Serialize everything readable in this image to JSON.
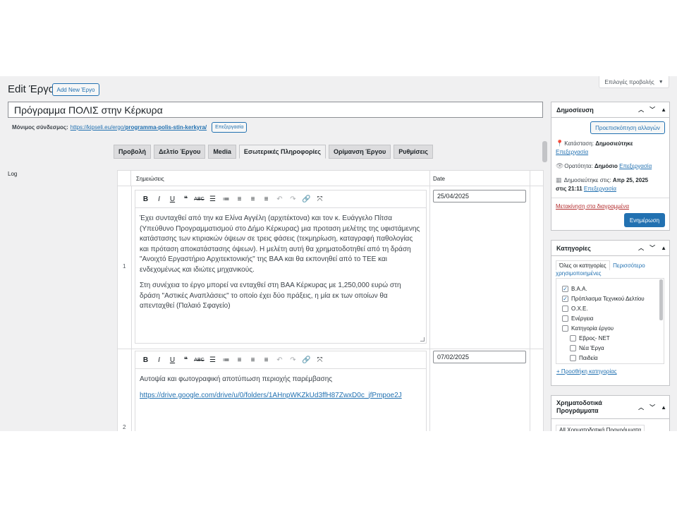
{
  "header": {
    "screen_options": "Επιλογές προβολής",
    "page_title": "Edit Έργο",
    "add_new": "Add New Έργο"
  },
  "post": {
    "title": "Πρόγραμμα ΠΟΛΙΣ στην Κέρκυρα",
    "permalink_label": "Μόνιμος σύνδεσμος:",
    "permalink_base": "https://kipseli.eu/ergo/",
    "permalink_slug": "programma-polis-stin-kerkyra/",
    "permalink_edit": "Επεξεργασία"
  },
  "tabs": [
    {
      "label": "Προβολή"
    },
    {
      "label": "Δελτίο Έργου"
    },
    {
      "label": "Media"
    },
    {
      "label": "Εσωτερικές Πληροφορίες",
      "active": true
    },
    {
      "label": "Ορίμανση Έργου"
    },
    {
      "label": "Ρυθμίσεις"
    }
  ],
  "log": {
    "label": "Log",
    "col_notes": "Σημειώσεις",
    "col_date": "Date",
    "rows": [
      {
        "num": "1",
        "date": "25/04/2025",
        "p1": "Έχει συνταχθεί από την κα Ελίνα Αγγέλη (αρχιτέκτονα) και τον κ. Ευάγγελο Πίτσα (Υπεύθυνο Προγραμματισμού στο Δήμο Κέρκυρας) μια προταση μελέτης της υφιστάμενης κατάστασης των κτιριακών όψεων σε τρεις φάσεις (τεκμηρίωση, καταγραφή παθολογίας και πρόταση αποκατάστασης όψεων). Η μελέτη αυτή θα χρηματοδοτηθεί από τη δράση \"Ανοιχτό Εργαστήριο Αρχιτεκτονικής\" της ΒΑΑ και θα εκπονηθεί από το ΤΕΕ και ενδεχομένως και ιδιώτες μηχανικούς.",
        "p2": "Στη συνέχεια το έργο μπορεί να ενταχθεί στη ΒΑΑ Κέρκυρας με 1,250,000 ευρώ στη δράση \"Αστικές Αναπλάσεις\" το οποίο έχει δύο πράξεις, η μία εκ των οποίων θα απενταχθεί (Παλαιό Σφαγείο)"
      },
      {
        "num": "2",
        "date": "07/02/2025",
        "p1": "Αυτοψία και φωτογραφική αποτύπωση περιοχής παρέμβασης",
        "link": "https://drive.google.com/drive/u/0/folders/1AHnpWKZkUd3ffH87ZwxD0c_jfPmpoe2J"
      }
    ]
  },
  "toolbar_icons": [
    "bold-icon",
    "italic-icon",
    "underline-icon",
    "blockquote-icon",
    "strikethrough-icon",
    "bullet-list-icon",
    "numbered-list-icon",
    "align-left-icon",
    "align-center-icon",
    "align-right-icon",
    "undo-icon",
    "redo-icon",
    "link-icon",
    "fullscreen-icon"
  ],
  "publish": {
    "title": "Δημοσίευση",
    "preview": "Προεπισκόπηση αλλαγών",
    "status_label": "Κατάσταση:",
    "status_value": "Δημοσιεύτηκε",
    "status_edit": "Επεξεργασία",
    "visibility_label": "Ορατότητα:",
    "visibility_value": "Δημόσιο",
    "visibility_edit": "Επεξεργασία",
    "published_label": "Δημοσιεύτηκε στις:",
    "published_value_a": "Απρ 25, 2025",
    "published_value_b": "στις 21:11",
    "published_edit": "Επεξεργασία",
    "trash": "Μετακίνηση στα διαγραμμένα",
    "update": "Ενημέρωση"
  },
  "categories": {
    "title": "Κατηγορίες",
    "tab_all": "Όλες οι κατηγορίες",
    "tab_popular_a": "Περισσότερο",
    "tab_popular_b": "χρησιμοποιημένες",
    "items": [
      {
        "label": "Β.Α.Α.",
        "checked": true
      },
      {
        "label": "Πρόπλασμα Τεχνικού Δελτίου",
        "checked": true
      },
      {
        "label": "Ο.Χ.Ε.",
        "checked": false
      },
      {
        "label": "Ενέργεια",
        "checked": false
      },
      {
        "label": "Κατηγορία έργου",
        "checked": false
      },
      {
        "label": "Εβρος- ΝΕΤ",
        "checked": false
      },
      {
        "label": "Νέα Έργα",
        "checked": false
      },
      {
        "label": "Παιδεία",
        "checked": false
      }
    ],
    "add_new": "+ Προσθήκη κατηγορίας"
  },
  "funds": {
    "title_a": "Χρηματοδοτικά",
    "title_b": "Προγράμματα",
    "tab_all": "All Χρηματοδοτικά Προγράμματα"
  }
}
